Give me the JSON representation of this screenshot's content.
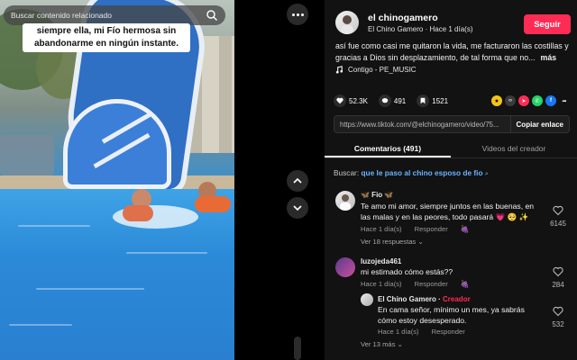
{
  "video": {
    "search_placeholder": "Buscar contenido relacionado",
    "caption": "siempre ella, mi Fío hermosa sin abandonarme en ningún instante."
  },
  "post": {
    "author_name": "el chinogamero",
    "author_sub": "El Chino Gamero · Hace 1 día(s)",
    "follow_label": "Seguir",
    "description": "así fue como casi me quitaron la vida, me facturaron las costillas y gracias a Dios sin desplazamiento, de tal forma que no...",
    "more_label": "más",
    "music": "Contigo - PE_MUSIC",
    "likes": "52.3K",
    "comments": "491",
    "saves": "1521",
    "link_url": "https://www.tiktok.com/@elchinogamero/video/75...",
    "copy_label": "Copiar enlace"
  },
  "tabs": [
    {
      "label": "Comentarios (491)"
    },
    {
      "label": "Videos del creador"
    }
  ],
  "search_suggestion": {
    "prefix": "Buscar:",
    "query": "que le paso al chino esposo de fio"
  },
  "comments": [
    {
      "author": "🦋 Fio 🦋",
      "text": "Te amo mi amor, siempre juntos en las buenas, en las malas y en las peores, todo pasará 💗 🥺 ✨",
      "time": "Hace 1 día(s)",
      "reply_label": "Responder",
      "replies": "Ver 18 respuestas",
      "likes": "6145"
    },
    {
      "author": "luzojeda461",
      "text": "mi estimado cómo estás??",
      "time": "Hace 1 día(s)",
      "reply_label": "Responder",
      "likes": "284"
    },
    {
      "author": "El Chino Gamero",
      "creator_tag": "Creador",
      "text": "En cama señor, mínimo un mes, ya sabrás cómo estoy desesperado.",
      "time": "Hace 1 día(s)",
      "reply_label": "Responder",
      "replies": "Ver 13 más",
      "likes": "532"
    }
  ],
  "colors": {
    "accent": "#fe2c55",
    "link": "#6ab3ff",
    "panel_bg": "#121212"
  }
}
